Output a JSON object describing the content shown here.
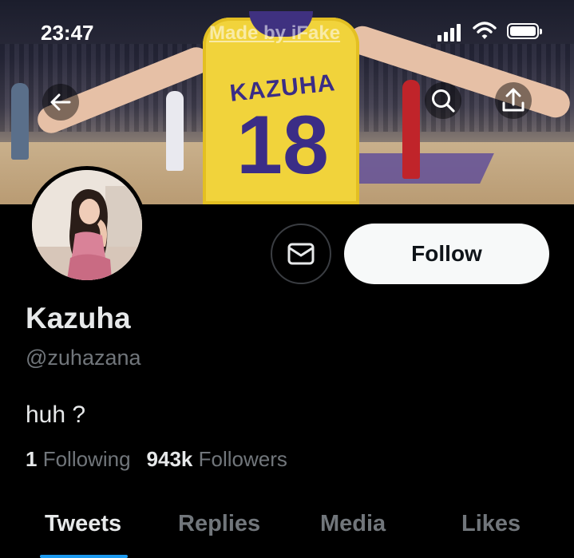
{
  "status_bar": {
    "time": "23:47"
  },
  "banner": {
    "watermark": "Made by iFake",
    "jersey_name": "KAZUHA",
    "jersey_number": "18"
  },
  "icons": {
    "back": "back-arrow-icon",
    "search": "search-icon",
    "share": "share-icon",
    "message": "mail-envelope-icon"
  },
  "profile": {
    "display_name": "Kazuha",
    "handle": "@zuhazana",
    "bio": "huh ?",
    "following_count": "1",
    "following_label": "Following",
    "followers_count": "943k",
    "followers_label": "Followers"
  },
  "actions": {
    "follow_label": "Follow"
  },
  "tabs": [
    {
      "label": "Tweets",
      "active": true
    },
    {
      "label": "Replies",
      "active": false
    },
    {
      "label": "Media",
      "active": false
    },
    {
      "label": "Likes",
      "active": false
    }
  ],
  "colors": {
    "background": "#000000",
    "primary_text": "#e7e9ea",
    "secondary_text": "#71767b",
    "follow_button_bg": "#f7f9f9",
    "accent": "#1d9bf0",
    "jersey_yellow": "#f1d33b",
    "jersey_purple": "#3b2d86"
  }
}
